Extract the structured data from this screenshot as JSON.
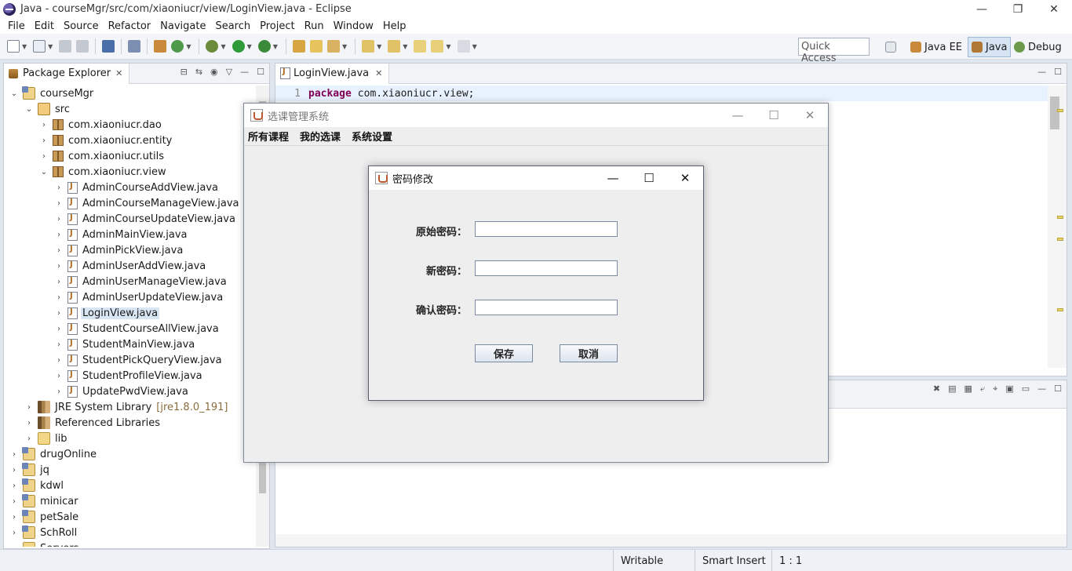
{
  "eclipse": {
    "title": "Java - courseMgr/src/com/xiaoniucr/view/LoginView.java - Eclipse",
    "window_controls": [
      "—",
      "❐",
      "✕"
    ],
    "menu": [
      "File",
      "Edit",
      "Source",
      "Refactor",
      "Navigate",
      "Search",
      "Project",
      "Run",
      "Window",
      "Help"
    ],
    "quick_access": "Quick Access",
    "perspectives": [
      "Java EE",
      "Java",
      "Debug"
    ]
  },
  "package_explorer": {
    "tab_label": "Package Explorer",
    "tree": [
      {
        "label": "courseMgr",
        "twisty": "⌄",
        "icon": "project"
      },
      {
        "label": "src",
        "twisty": "⌄",
        "icon": "src"
      },
      {
        "label": "com.xiaoniucr.dao",
        "twisty": "›",
        "icon": "pkg"
      },
      {
        "label": "com.xiaoniucr.entity",
        "twisty": "›",
        "icon": "pkg"
      },
      {
        "label": "com.xiaoniucr.utils",
        "twisty": "›",
        "icon": "pkg"
      },
      {
        "label": "com.xiaoniucr.view",
        "twisty": "⌄",
        "icon": "pkg"
      },
      {
        "label": "AdminCourseAddView.java",
        "twisty": "›",
        "icon": "java"
      },
      {
        "label": "AdminCourseManageView.java",
        "twisty": "›",
        "icon": "java"
      },
      {
        "label": "AdminCourseUpdateView.java",
        "twisty": "›",
        "icon": "java"
      },
      {
        "label": "AdminMainView.java",
        "twisty": "›",
        "icon": "java"
      },
      {
        "label": "AdminPickView.java",
        "twisty": "›",
        "icon": "java"
      },
      {
        "label": "AdminUserAddView.java",
        "twisty": "›",
        "icon": "java"
      },
      {
        "label": "AdminUserManageView.java",
        "twisty": "›",
        "icon": "java"
      },
      {
        "label": "AdminUserUpdateView.java",
        "twisty": "›",
        "icon": "java"
      },
      {
        "label": "LoginView.java",
        "twisty": "›",
        "icon": "java",
        "selected": true
      },
      {
        "label": "StudentCourseAllView.java",
        "twisty": "›",
        "icon": "java"
      },
      {
        "label": "StudentMainView.java",
        "twisty": "›",
        "icon": "java"
      },
      {
        "label": "StudentPickQueryView.java",
        "twisty": "›",
        "icon": "java"
      },
      {
        "label": "StudentProfileView.java",
        "twisty": "›",
        "icon": "java"
      },
      {
        "label": "UpdatePwdView.java",
        "twisty": "›",
        "icon": "java"
      },
      {
        "label": "JRE System Library",
        "suffix": "[jre1.8.0_191]",
        "twisty": "›",
        "icon": "lib"
      },
      {
        "label": "Referenced Libraries",
        "twisty": "›",
        "icon": "lib"
      },
      {
        "label": "lib",
        "twisty": "›",
        "icon": "folder"
      },
      {
        "label": "drugOnline",
        "twisty": "›",
        "icon": "project"
      },
      {
        "label": "jq",
        "twisty": "›",
        "icon": "project"
      },
      {
        "label": "kdwl",
        "twisty": "›",
        "icon": "project"
      },
      {
        "label": "minicar",
        "twisty": "›",
        "icon": "project"
      },
      {
        "label": "petSale",
        "twisty": "›",
        "icon": "project"
      },
      {
        "label": "SchRoll",
        "twisty": "›",
        "icon": "project"
      },
      {
        "label": "Servers",
        "twisty": "›",
        "icon": "folder"
      }
    ]
  },
  "editor": {
    "tab_label": "LoginView.java",
    "line_number": "1",
    "keyword": "package",
    "code_rest": "com.xiaoniucr.view;"
  },
  "status": {
    "writable": "Writable",
    "insert_mode": "Smart Insert",
    "position": "1 : 1"
  },
  "swing_main": {
    "title": "选课管理系统",
    "menu": [
      "所有课程",
      "我的选课",
      "系统设置"
    ]
  },
  "pwd_dialog": {
    "title": "密码修改",
    "old_label": "原始密码：",
    "old_value": "",
    "new_label": "新密码：",
    "new_value": "",
    "confirm_label": "确认密码：",
    "confirm_value": "",
    "save_label": "保存",
    "cancel_label": "取消"
  }
}
